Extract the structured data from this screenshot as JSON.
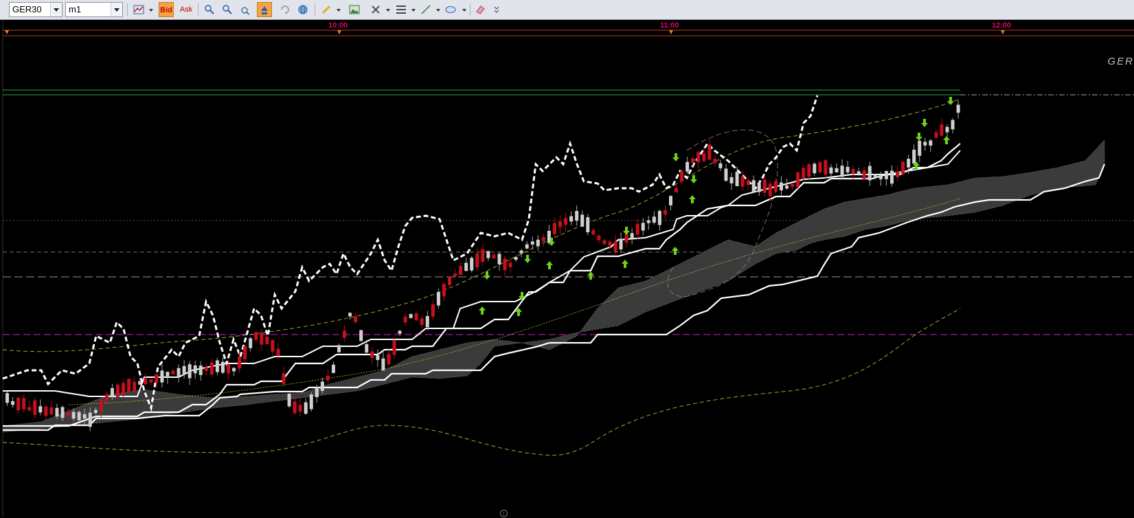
{
  "toolbar": {
    "symbol": "GER30",
    "timeframe": "m1",
    "bid_label": "Bid",
    "ask_label": "Ask"
  },
  "chart": {
    "time_labels": [
      "10:00",
      "11:00",
      "12:00"
    ],
    "symbol_watermark": "GER",
    "info_glyph": "i"
  },
  "colors": {
    "background": "#000000",
    "time_axis": "#d40a6a",
    "bull_candle": "#d0d0d0",
    "bear_candle": "#c8101c",
    "signal_arrow": "#6ed21a",
    "cloud": "#3a3a3a",
    "upper_band": "#22aa44",
    "magenta_level": "#cc22cc",
    "yellow_band": "#c8c840"
  }
}
